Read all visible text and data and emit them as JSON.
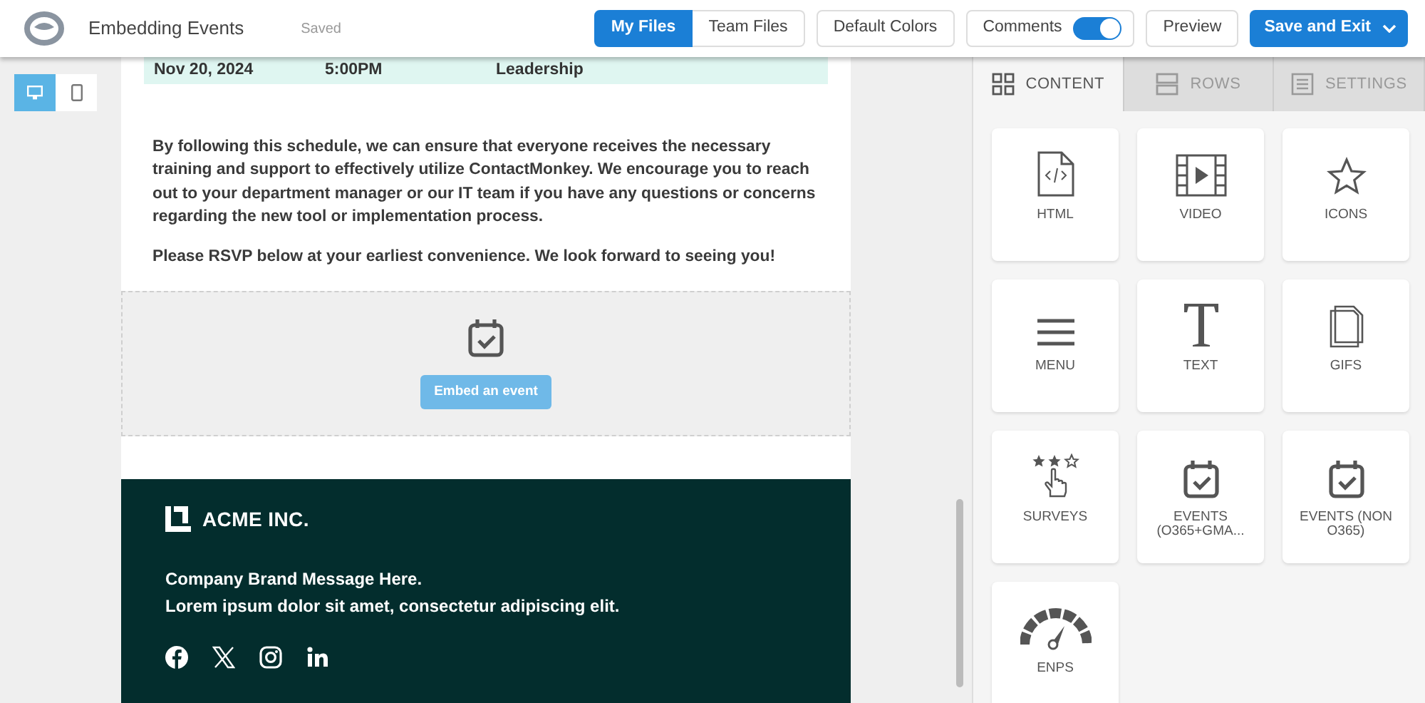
{
  "header": {
    "title": "Embedding Events",
    "status": "Saved",
    "file_tabs": [
      {
        "label": "My Files",
        "selected": true
      },
      {
        "label": "Team Files",
        "selected": false
      }
    ],
    "default_colors": "Default Colors",
    "comments": {
      "label": "Comments",
      "on": true
    },
    "preview": "Preview",
    "save": "Save and Exit"
  },
  "view_toggle": [
    {
      "kind": "desktop",
      "selected": true
    },
    {
      "kind": "mobile",
      "selected": false
    }
  ],
  "email": {
    "schedule_row": [
      "Nov 20, 2024",
      "5:00PM",
      "Leadership"
    ],
    "paragraphs": [
      "By following this schedule, we can ensure that everyone receives the necessary training and support to effectively utilize ContactMonkey. We encourage you to reach out to your department manager or our IT team if you have any questions or concerns regarding the new tool or implementation process.",
      "Please RSVP below at your earliest convenience. We look forward to seeing you!"
    ],
    "event_button": "Embed an event",
    "footer": {
      "brand": "ACME INC.",
      "message": [
        "Company Brand Message Here.",
        "Lorem ipsum dolor sit amet, consectetur adipiscing elit."
      ],
      "social": [
        {
          "kind": "facebook"
        },
        {
          "kind": "x"
        },
        {
          "kind": "instagram"
        },
        {
          "kind": "linkedin"
        }
      ]
    }
  },
  "panel_tabs": [
    {
      "label": "CONTENT",
      "kind": "grid",
      "selected": true
    },
    {
      "label": "ROWS",
      "kind": "rows",
      "selected": false
    },
    {
      "label": "SETTINGS",
      "kind": "settings",
      "selected": false
    }
  ],
  "tiles": [
    {
      "label": "HTML",
      "kind": "html"
    },
    {
      "label": "VIDEO",
      "kind": "video"
    },
    {
      "label": "ICONS",
      "kind": "star"
    },
    {
      "label": "MENU",
      "kind": "menu"
    },
    {
      "label": "TEXT",
      "kind": "text"
    },
    {
      "label": "GIFS",
      "kind": "gif"
    },
    {
      "label": "SURVEYS",
      "kind": "survey"
    },
    {
      "label": "EVENTS (O365+GMA...",
      "kind": "event"
    },
    {
      "label": "EVENTS (NON O365)",
      "kind": "event"
    },
    {
      "label": "ENPS",
      "kind": "gauge"
    }
  ]
}
